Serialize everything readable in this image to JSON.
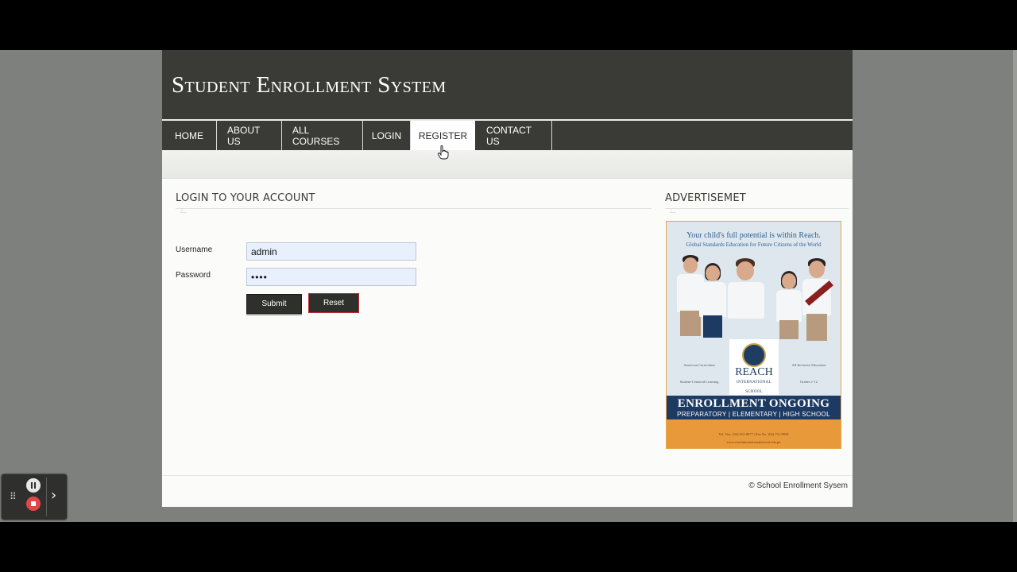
{
  "site": {
    "title": "Student Enrollment System"
  },
  "nav": {
    "items": [
      {
        "label": "HOME"
      },
      {
        "label": "ABOUT US"
      },
      {
        "label": "ALL COURSES"
      },
      {
        "label": "LOGIN"
      },
      {
        "label": "REGISTER",
        "active": true
      },
      {
        "label": "CONTACT US"
      }
    ]
  },
  "login": {
    "heading": "LOGIN TO YOUR ACCOUNT",
    "username_label": "Username",
    "username_value": "admin",
    "password_label": "Password",
    "password_value": "••••",
    "submit_label": "Submit",
    "reset_label": "Reset"
  },
  "ad": {
    "heading": "ADVERTISEMET",
    "poster": {
      "tagline": "Your child's full potential is within Reach.",
      "subtagline": "Global Standards Education for Future Citizens of the World",
      "school_name_1": "REACH",
      "school_name_2": "INTERNATIONAL SCHOOL",
      "features": [
        "American Curriculum",
        "All-Inclusive Education",
        "Student-Centered Learning",
        "Grades 1-12"
      ],
      "banner": "ENROLLMENT ONGOING",
      "levels": "PREPARATORY | ELEMENTARY | HIGH SCHOOL",
      "contact": "Tel. Nos. (02) 812-8077 | Fax No. (02) 751-9938",
      "website": "www.reachinternationalschool.edu.ph"
    }
  },
  "footer": {
    "text": "© School Enrollment Sysem"
  },
  "colors": {
    "header_bg": "#3a3b36",
    "page_bg": "#7d807c",
    "input_bg": "#e8f0fe",
    "reset_border": "#c0272d",
    "ad_band": "#1d3a63",
    "ad_bottom": "#e89a3a"
  },
  "recorder": {
    "icons": [
      "drag-handle-icon",
      "pause-icon",
      "stop-icon",
      "chevron-right-icon"
    ]
  }
}
